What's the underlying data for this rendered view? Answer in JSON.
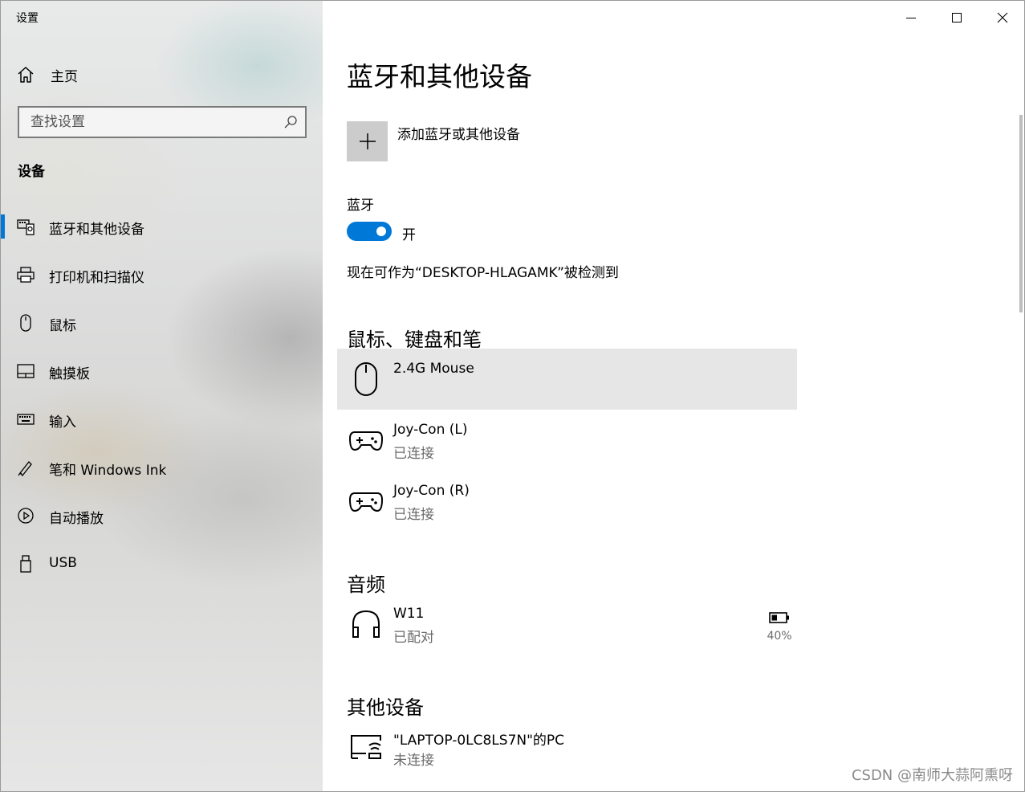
{
  "window": {
    "title": "设置",
    "controls": {
      "minimize_icon": "minimize-icon",
      "maximize_icon": "maximize-icon",
      "close_icon": "close-icon"
    }
  },
  "sidebar": {
    "home_label": "主页",
    "search_placeholder": "查找设置",
    "section_title": "设备",
    "items": [
      {
        "label": "蓝牙和其他设备",
        "icon": "bluetooth-devices-icon",
        "selected": true
      },
      {
        "label": "打印机和扫描仪",
        "icon": "printer-icon",
        "selected": false
      },
      {
        "label": "鼠标",
        "icon": "mouse-icon",
        "selected": false
      },
      {
        "label": "触摸板",
        "icon": "touchpad-icon",
        "selected": false
      },
      {
        "label": "输入",
        "icon": "keyboard-icon",
        "selected": false
      },
      {
        "label": "笔和 Windows Ink",
        "icon": "pen-icon",
        "selected": false
      },
      {
        "label": "自动播放",
        "icon": "autoplay-icon",
        "selected": false
      },
      {
        "label": "USB",
        "icon": "usb-icon",
        "selected": false
      }
    ]
  },
  "main": {
    "title": "蓝牙和其他设备",
    "add_device_label": "添加蓝牙或其他设备",
    "bluetooth": {
      "label": "蓝牙",
      "state": "开",
      "on": true
    },
    "discoverable_text": "现在可作为“DESKTOP-HLAGAMK”被检测到",
    "groups": {
      "input": {
        "title": "鼠标、键盘和笔",
        "devices": [
          {
            "name": "2.4G Mouse",
            "status": "",
            "icon": "mouse-icon"
          },
          {
            "name": "Joy-Con (L)",
            "status": "已连接",
            "icon": "gamepad-icon"
          },
          {
            "name": "Joy-Con (R)",
            "status": "已连接",
            "icon": "gamepad-icon"
          }
        ]
      },
      "audio": {
        "title": "音频",
        "devices": [
          {
            "name": "W11",
            "status": "已配对",
            "icon": "headphones-icon",
            "battery": "40%"
          }
        ]
      },
      "other": {
        "title": "其他设备",
        "devices": [
          {
            "name": "\"LAPTOP-0LC8LS7N\"的PC",
            "status": "未连接",
            "icon": "wireless-display-icon"
          }
        ]
      }
    }
  },
  "watermark": "CSDN @南师大蒜阿熏呀",
  "colors": {
    "accent": "#0078d7",
    "selected_row": "#e6e6e6",
    "secondary_text": "#6b6b6b"
  }
}
